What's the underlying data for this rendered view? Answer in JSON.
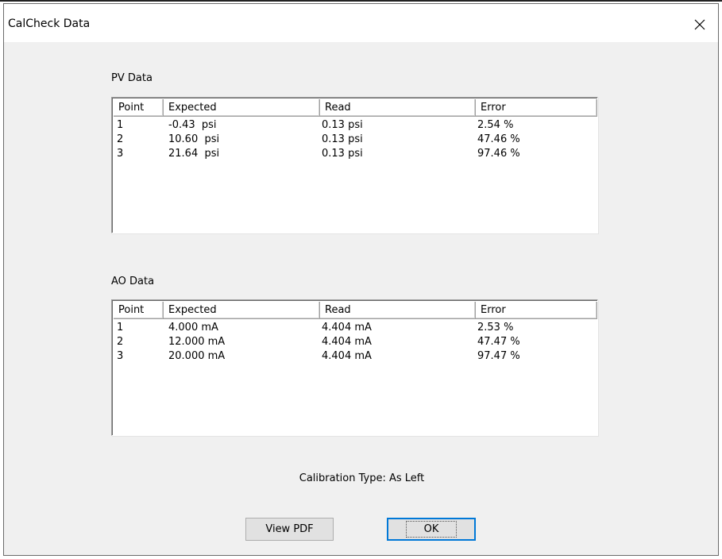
{
  "window": {
    "title": "CalCheck Data",
    "close_icon": "close-icon"
  },
  "pv": {
    "label": "PV Data",
    "columns": [
      "Point",
      "Expected",
      "Read",
      "Error"
    ],
    "rows": [
      [
        "1",
        "-0.43  psi",
        "0.13 psi",
        "2.54 %"
      ],
      [
        "2",
        "10.60  psi",
        "0.13 psi",
        "47.46 %"
      ],
      [
        "3",
        "21.64  psi",
        "0.13 psi",
        "97.46 %"
      ]
    ]
  },
  "ao": {
    "label": "AO Data",
    "columns": [
      "Point",
      "Expected",
      "Read",
      "Error"
    ],
    "rows": [
      [
        "1",
        "4.000 mA",
        "4.404 mA",
        "2.53 %"
      ],
      [
        "2",
        "12.000 mA",
        "4.404 mA",
        "47.47 %"
      ],
      [
        "3",
        "20.000 mA",
        "4.404 mA",
        "97.47 %"
      ]
    ]
  },
  "calibration_type": "Calibration Type: As Left",
  "buttons": {
    "view_pdf": "View PDF",
    "ok": "OK"
  },
  "colors": {
    "window_bg": "#f0f0f0",
    "button_bg": "#e1e1e1",
    "default_border": "#0078d7"
  }
}
